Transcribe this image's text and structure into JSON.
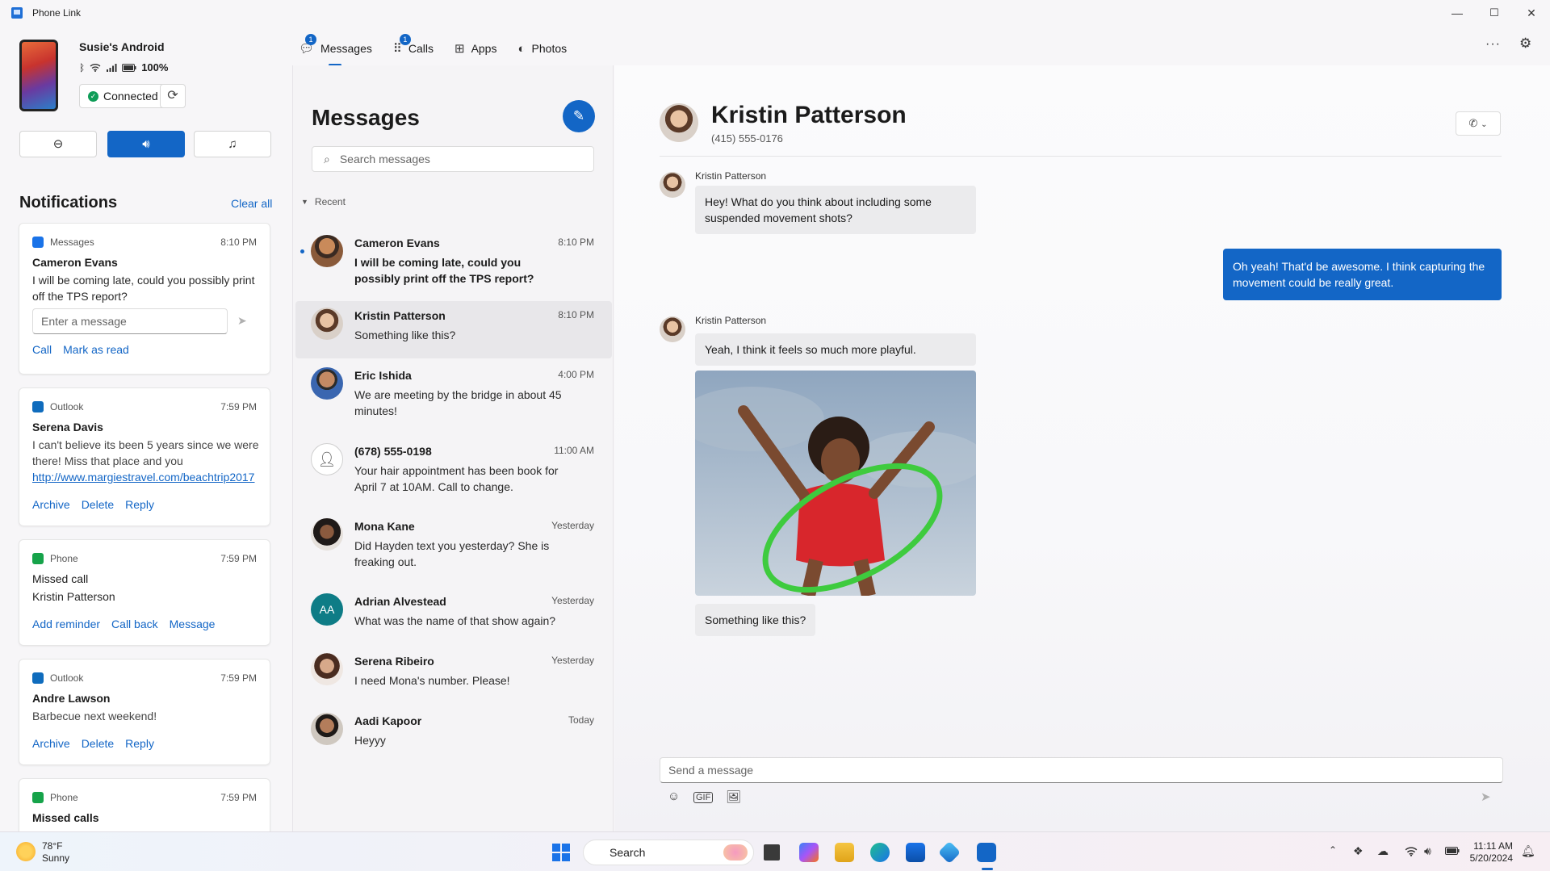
{
  "window": {
    "title": "Phone Link",
    "minimize": "—",
    "maximize": "☐",
    "close": "✕"
  },
  "device": {
    "name": "Susie's Android",
    "battery": "100%",
    "connection": "Connected",
    "quick_actions": [
      "do-not-disturb",
      "audio",
      "music"
    ]
  },
  "notifications": {
    "heading": "Notifications",
    "clear_all": "Clear all",
    "items": [
      {
        "app": "Messages",
        "time": "8:10 PM",
        "sender": "Cameron Evans",
        "body": "I will be coming late, could you possibly print off the TPS report?",
        "reply_placeholder": "Enter a message",
        "actions": [
          "Call",
          "Mark as read"
        ],
        "color": "#1a73e8"
      },
      {
        "app": "Outlook",
        "time": "7:59 PM",
        "sender": "Serena Davis",
        "body": "I can't believe its been 5 years since we were there! Miss that place and you",
        "link": "http://www.margiestravel.com/beachtrip2017",
        "actions": [
          "Archive",
          "Delete",
          "Reply"
        ],
        "color": "#0f6cbd"
      },
      {
        "app": "Phone",
        "time": "7:59 PM",
        "sender": "Missed call",
        "body": "Kristin Patterson",
        "actions": [
          "Add reminder",
          "Call back",
          "Message"
        ],
        "color": "#16a34a"
      },
      {
        "app": "Outlook",
        "time": "7:59 PM",
        "sender": "Andre Lawson",
        "body": "Barbecue next weekend!",
        "actions": [
          "Archive",
          "Delete",
          "Reply"
        ],
        "color": "#0f6cbd"
      },
      {
        "app": "Phone",
        "time": "7:59 PM",
        "sender": "Missed calls",
        "body": "",
        "actions": [],
        "color": "#16a34a"
      }
    ]
  },
  "nav": {
    "tabs": [
      {
        "label": "Messages",
        "badge": "1",
        "icon": "chat-icon"
      },
      {
        "label": "Calls",
        "badge": "1",
        "icon": "dialpad-icon"
      },
      {
        "label": "Apps",
        "icon": "apps-icon"
      },
      {
        "label": "Photos",
        "icon": "photos-icon"
      }
    ],
    "more": "···",
    "settings": "⚙"
  },
  "messages": {
    "title": "Messages",
    "search_placeholder": "Search messages",
    "section": "Recent",
    "conversations": [
      {
        "name": "Cameron Evans",
        "time": "8:10 PM",
        "preview": "I will be coming late, could you possibly print off the TPS report?",
        "unread": true
      },
      {
        "name": "Kristin Patterson",
        "time": "8:10 PM",
        "preview": "Something like this?",
        "selected": true
      },
      {
        "name": "Eric Ishida",
        "time": "4:00 PM",
        "preview": "We are meeting by the bridge in about 45 minutes!"
      },
      {
        "name": "(678) 555-0198",
        "time": "11:00 AM",
        "preview": "Your hair appointment has been book for April 7 at 10AM. Call to change."
      },
      {
        "name": "Mona Kane",
        "time": "Yesterday",
        "preview": "Did Hayden text you yesterday? She is freaking out."
      },
      {
        "name": "Adrian Alvestead",
        "time": "Yesterday",
        "preview": "What was the name of that show again?",
        "initials": "AA"
      },
      {
        "name": "Serena Ribeiro",
        "time": "Yesterday",
        "preview": "I need Mona's number. Please!"
      },
      {
        "name": "Aadi Kapoor",
        "time": "Today",
        "preview": "Heyyy"
      }
    ]
  },
  "conversation": {
    "contact_name": "Kristin Patterson",
    "contact_number": "(415) 555-0176",
    "thread": [
      {
        "from": "Kristin Patterson",
        "text": "Hey! What do you think about including some suspended movement shots?"
      },
      {
        "from": "me",
        "text": "Oh yeah! That'd be awesome. I think capturing the movement could be really great."
      },
      {
        "from": "Kristin Patterson",
        "text": "Yeah, I think it feels so much more playful."
      },
      {
        "from": "Kristin Patterson",
        "text": "Something like this?"
      }
    ],
    "compose_placeholder": "Send a message"
  },
  "taskbar": {
    "weather_temp": "78°F",
    "weather_desc": "Sunny",
    "search": "Search",
    "time": "11:11 AM",
    "date": "5/20/2024"
  }
}
